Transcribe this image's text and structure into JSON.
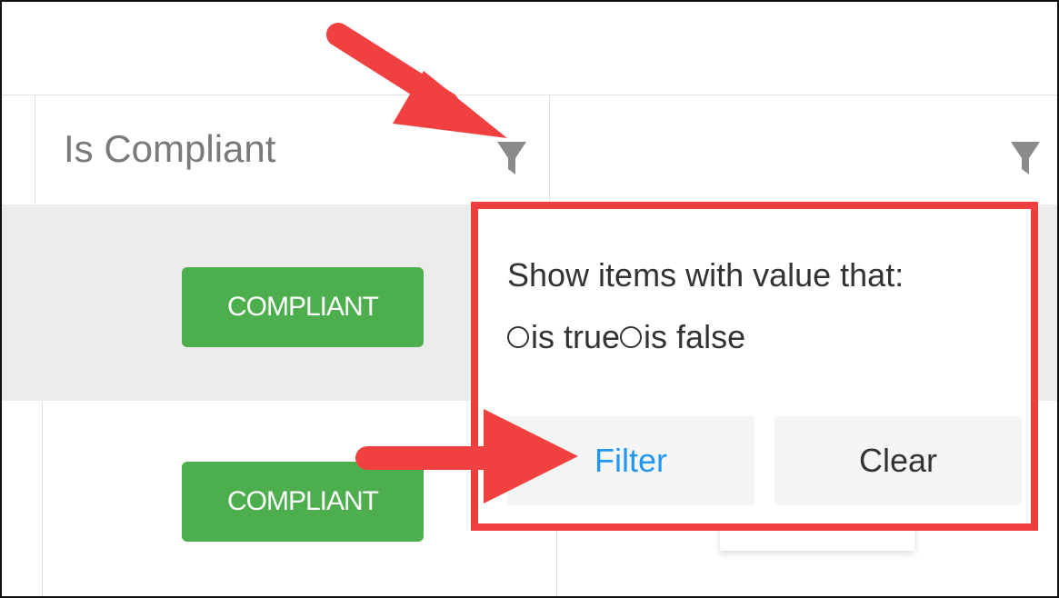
{
  "grid": {
    "columns": [
      {
        "header": "Is Compliant",
        "icon": "filter-icon"
      },
      {
        "header": "",
        "icon": "filter-icon"
      }
    ],
    "rows": [
      {
        "is_compliant_badge": "COMPLIANT"
      },
      {
        "is_compliant_badge": "COMPLIANT"
      }
    ],
    "badge_color": "#4cae4c"
  },
  "filter_popup": {
    "title": "Show items with value that:",
    "options": [
      {
        "label": "is true",
        "selected": false
      },
      {
        "label": "is false",
        "selected": false
      }
    ],
    "filter_label": "Filter",
    "clear_label": "Clear",
    "highlight_color": "#f03e3e",
    "filter_label_color": "#2196f3"
  },
  "annotations": {
    "arrow_color": "#f04040"
  }
}
